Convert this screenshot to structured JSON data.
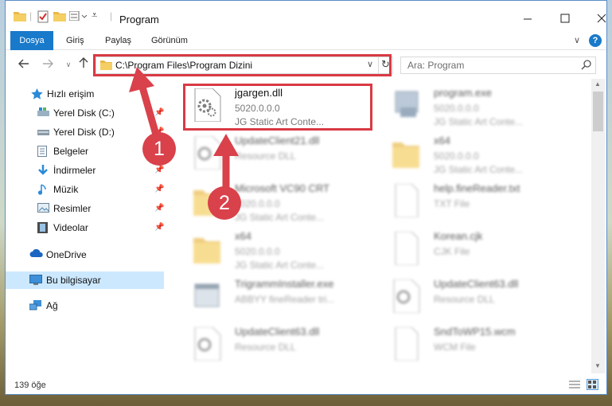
{
  "window": {
    "title": "Program",
    "controls": [
      "minimize",
      "maximize",
      "close"
    ]
  },
  "ribbon": {
    "tabs": [
      "Dosya",
      "Giriş",
      "Paylaş",
      "Görünüm"
    ],
    "file_tab_color": "#1979ca"
  },
  "nav": {
    "address": "C:\\Program Files\\Program Dizini",
    "search_placeholder": "Ara: Program"
  },
  "sidebar": {
    "items": [
      {
        "label": "Hızlı erişim",
        "icon": "star-icon",
        "pinned": false
      },
      {
        "label": "Yerel Disk (C:)",
        "icon": "drive-icon",
        "pinned": true
      },
      {
        "label": "Yerel Disk (D:)",
        "icon": "drive-icon",
        "pinned": true
      },
      {
        "label": "Belgeler",
        "icon": "document-icon",
        "pinned": true
      },
      {
        "label": "İndirmeler",
        "icon": "download-icon",
        "pinned": true
      },
      {
        "label": "Müzik",
        "icon": "music-icon",
        "pinned": true
      },
      {
        "label": "Resimler",
        "icon": "pictures-icon",
        "pinned": true
      },
      {
        "label": "Videolar",
        "icon": "video-icon",
        "pinned": true
      },
      {
        "label": "OneDrive",
        "icon": "cloud-icon",
        "pinned": false
      },
      {
        "label": "Bu bilgisayar",
        "icon": "computer-icon",
        "pinned": false,
        "selected": true
      },
      {
        "label": "Ağ",
        "icon": "network-icon",
        "pinned": false
      }
    ]
  },
  "files": [
    {
      "name": "jgargen.dll",
      "line1": "5020.0.0.0",
      "line2": "JG Static Art Conte...",
      "type": "dll",
      "highlighted": true
    },
    {
      "name": "program.exe",
      "line1": "5020.0.0.0",
      "line2": "JG Static Art Conte...",
      "type": "exe"
    },
    {
      "name": "UpdateClient21.dll",
      "line1": "Resource DLL",
      "line2": "",
      "type": "dll"
    },
    {
      "name": "x64",
      "line1": "5020.0.0.0",
      "line2": "JG Static Art Conte...",
      "type": "folder"
    },
    {
      "name": "Microsoft VC90 CRT",
      "line1": "5020.0.0.0",
      "line2": "JG Static Art Conte...",
      "type": "folder"
    },
    {
      "name": "help.fineReader.txt",
      "line1": "TXT File",
      "line2": "",
      "type": "txt"
    },
    {
      "name": "x64",
      "line1": "5020.0.0.0",
      "line2": "JG Static Art Conte...",
      "type": "folder"
    },
    {
      "name": "Korean.cjk",
      "line1": "CJK File",
      "line2": "",
      "type": "txt"
    },
    {
      "name": "TrigrammInstaller.exe",
      "line1": "ABBYY fineReader tri...",
      "line2": "",
      "type": "exe"
    },
    {
      "name": "UpdateClient63.dll",
      "line1": "Resource DLL",
      "line2": "",
      "type": "dll"
    },
    {
      "name": "UpdateClient63.dll",
      "line1": "Resource DLL",
      "line2": "",
      "type": "dll"
    },
    {
      "name": "SndToWP15.wcm",
      "line1": "WCM File",
      "line2": "",
      "type": "txt"
    }
  ],
  "status": {
    "item_count": "139 öğe"
  },
  "annotations": {
    "step1": "1",
    "step2": "2",
    "highlight_color": "#d93a44"
  }
}
